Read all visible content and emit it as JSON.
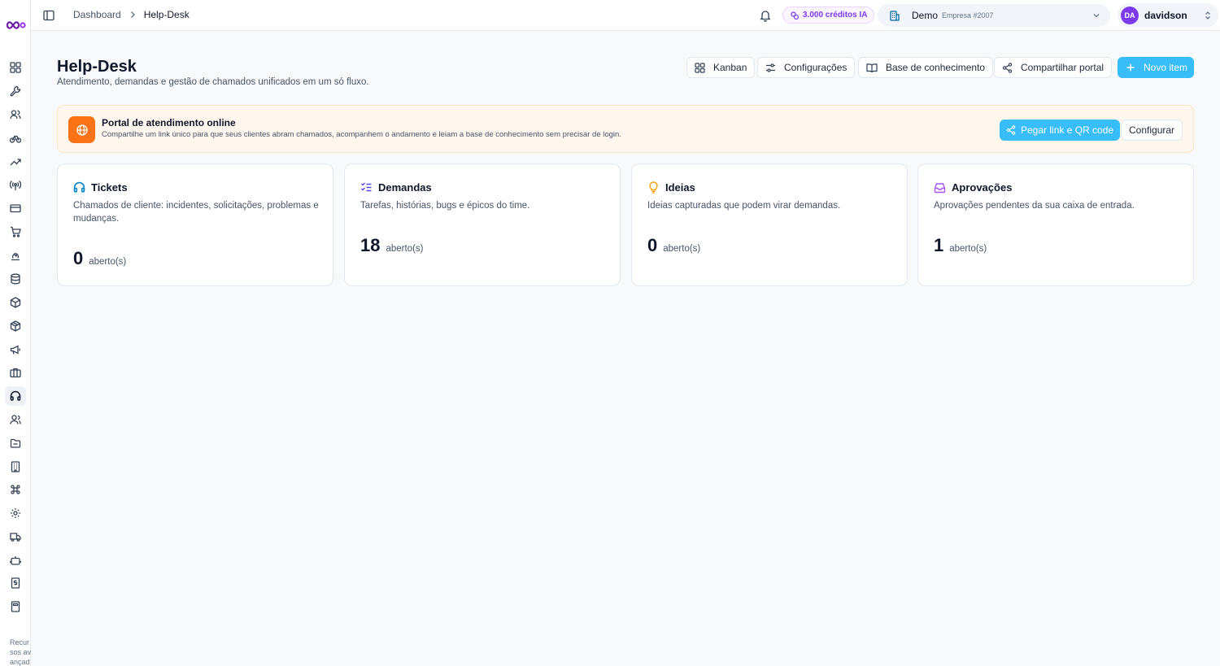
{
  "topbar": {
    "breadcrumb": [
      "Dashboard",
      "Help-Desk"
    ],
    "credits": "3.000 créditos IA",
    "company": {
      "name": "Demo",
      "sub": "Empresa #2007"
    },
    "user": {
      "initials": "DA",
      "name": "davidson"
    }
  },
  "sidebar": {
    "icons": [
      "grid-icon",
      "wrench-icon",
      "users-icon",
      "bike-icon",
      "trending-up-icon",
      "antenna-icon",
      "credit-card-icon",
      "cart-icon",
      "fire-icon",
      "database-icon",
      "package-icon",
      "box-icon",
      "megaphone-icon",
      "briefcase-icon",
      "headphones-icon",
      "contacts-icon",
      "folder-icon",
      "building-icon",
      "command-icon",
      "settings-icon",
      "truck-icon",
      "robot-icon",
      "dollar-file-icon",
      "calculator-icon"
    ],
    "active": "headphones-icon",
    "footer": "Recursos avançados"
  },
  "header": {
    "title": "Help-Desk",
    "subtitle": "Atendimento, demandas e gestão de chamados unificados em um só fluxo.",
    "buttons": {
      "kanban": "Kanban",
      "settings": "Configurações",
      "knowledge": "Base de conhecimento",
      "share": "Compartilhar portal",
      "new": "Novo item"
    }
  },
  "banner": {
    "title": "Portal de atendimento online",
    "text": "Compartilhe um link único para que seus clientes abram chamados, acompanhem o andamento e leiam a base de conhecimento sem precisar de login.",
    "primary": "Pegar link e QR code",
    "secondary": "Configurar"
  },
  "cards": [
    {
      "title": "Tickets",
      "desc": "Chamados de cliente: incidentes, solicitações, problemas e mudanças.",
      "count": "0",
      "unit": "aberto(s)",
      "color": "#0284c7"
    },
    {
      "title": "Demandas",
      "desc": "Tarefas, histórias, bugs e épicos do time.",
      "count": "18",
      "unit": "aberto(s)",
      "color": "#4f46e5"
    },
    {
      "title": "Ideias",
      "desc": "Ideias capturadas que podem virar demandas.",
      "count": "0",
      "unit": "aberto(s)",
      "color": "#f59e0b"
    },
    {
      "title": "Aprovações",
      "desc": "Aprovações pendentes da sua caixa de entrada.",
      "count": "1",
      "unit": "aberto(s)",
      "color": "#a855f7"
    }
  ]
}
